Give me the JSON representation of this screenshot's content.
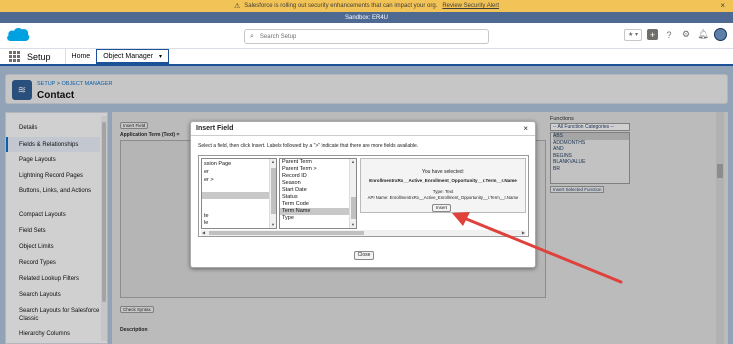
{
  "alert": {
    "message": "Salesforce is rolling out security enhancements that can impact your org.",
    "link": "Review Security Alert",
    "close": "×"
  },
  "sandbox": {
    "label": "Sandbox: ER4U"
  },
  "header": {
    "search_placeholder": "Search Setup",
    "fav_label": "★ ▾"
  },
  "appbar": {
    "app_name": "Setup",
    "tabs": [
      {
        "label": "Home"
      },
      {
        "label": "Object Manager"
      }
    ]
  },
  "page": {
    "breadcrumb_1": "SETUP",
    "breadcrumb_sep": " > ",
    "breadcrumb_2": "OBJECT MANAGER",
    "title": "Contact"
  },
  "sidebar": {
    "items": [
      {
        "label": "Details"
      },
      {
        "label": "Fields & Relationships"
      },
      {
        "label": "Page Layouts"
      },
      {
        "label": "Lightning Record Pages"
      },
      {
        "label": "Buttons, Links, and Actions"
      },
      {
        "label": "Compact Layouts"
      },
      {
        "label": "Field Sets"
      },
      {
        "label": "Object Limits"
      },
      {
        "label": "Record Types"
      },
      {
        "label": "Related Lookup Filters"
      },
      {
        "label": "Search Layouts"
      },
      {
        "label": "Search Layouts for Salesforce Classic"
      },
      {
        "label": "Hierarchy Columns"
      }
    ]
  },
  "content": {
    "insert_field_btn": "Insert Field",
    "app_term_label": "Application Term (Text) =",
    "check_syntax_btn": "Check Syntax",
    "description_label": "Description",
    "functions": {
      "label": "Functions",
      "category": "-- All Function Categories --",
      "items": [
        "ABS",
        "ADDMONTHS",
        "AND",
        "BEGINS",
        "BLANKVALUE",
        "BR"
      ],
      "insert_btn": "Insert Selected Function"
    }
  },
  "dialog": {
    "title": "Insert Field",
    "close": "×",
    "instructions": "Select a field, then click Insert. Labels followed by a \">\" indicate that there are more fields available.",
    "list_a": [
      "ssion Page",
      "er",
      "er >",
      "",
      "",
      "",
      "",
      "te",
      "le"
    ],
    "list_b": [
      "Parent Term",
      "Parent Term >",
      "Record ID",
      "Season",
      "Start Date",
      "Status",
      "Term Code",
      "Term Name",
      "Type"
    ],
    "detail": {
      "you_selected": "You have selected:",
      "selected_field": "EnrollmentrxRx__Active_Enrollment_Opportunity__r.Term__r.Name",
      "type": "Type: Text",
      "api_name": "API Name: EnrollmentrxRx__Active_Enrollment_Opportunity__r.Term__r.Name",
      "insert": "Insert"
    },
    "close_btn": "Close"
  },
  "colors": {
    "alert": "#f2c356",
    "sandbox": "#4f6a92",
    "brand": "#00a1e0",
    "arrow": "#e0413a"
  }
}
